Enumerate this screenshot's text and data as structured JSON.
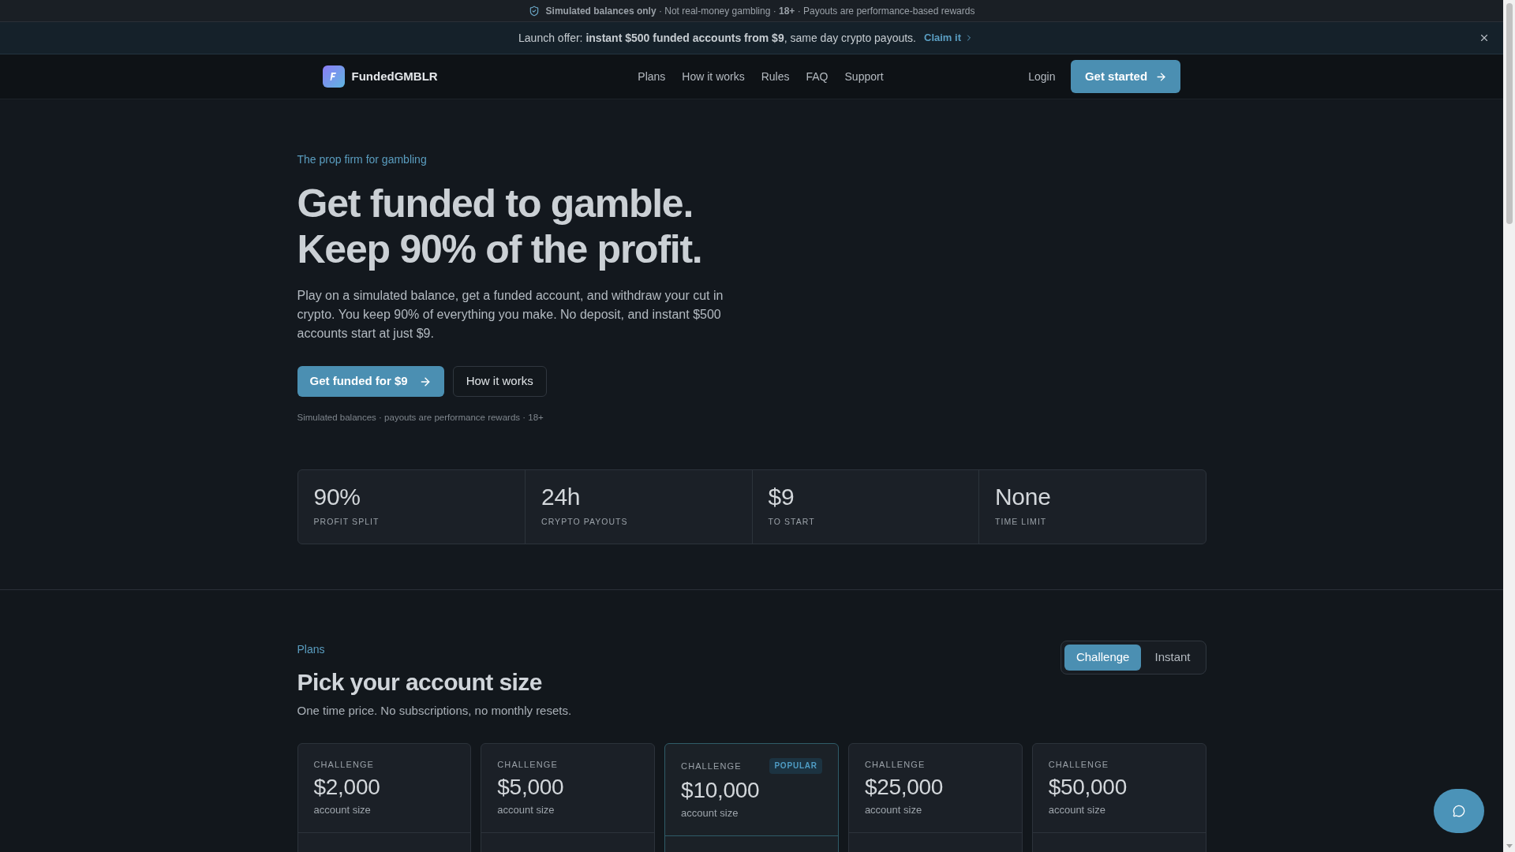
{
  "notice_bar": {
    "text": "**Simulated balances only** · Not real-money gambling · **18+** · Payouts are performance-based rewards"
  },
  "offer_bar": {
    "text": "Launch offer: **instant $500 funded accounts from $9**, same day crypto payouts.",
    "link": "Claim it"
  },
  "nav": {
    "brand": "FundedGMBLR",
    "links": [
      "Plans",
      "How it works",
      "Rules",
      "FAQ",
      "Support"
    ],
    "login": "Login",
    "cta": "Get started"
  },
  "hero": {
    "eyebrow": "The prop firm for gambling",
    "headline": [
      "Get funded to gamble.",
      "Keep 90% of the profit."
    ],
    "body": "Play on a simulated balance, get a funded account, and withdraw your cut in crypto. You keep 90% of everything you make. No deposit, and instant $500 accounts start at just $9.",
    "buttons": [
      {
        "label": "Get funded for $9",
        "kind": "primary"
      },
      {
        "label": "How it works",
        "kind": "secondary"
      }
    ],
    "note": "Simulated balances · payouts are performance rewards · 18+"
  },
  "stats": [
    {
      "value": "90%",
      "label": "PROFIT SPLIT"
    },
    {
      "value": "24h",
      "label": "CRYPTO PAYOUTS"
    },
    {
      "value": "$9",
      "label": "TO START"
    },
    {
      "value": "None",
      "label": "TIME LIMIT"
    }
  ],
  "plans": {
    "eyebrow": "Plans",
    "title": "Pick your account size",
    "subtitle": "One time price. No subscriptions, no monthly resets.",
    "toggle": [
      {
        "label": "Challenge",
        "selected": true
      },
      {
        "label": "Instant",
        "selected": false
      }
    ],
    "cards": [
      {
        "type_label": "CHALLENGE",
        "price": "$2,000",
        "caption": "account size",
        "popular": false
      },
      {
        "type_label": "CHALLENGE",
        "price": "$5,000",
        "caption": "account size",
        "popular": false
      },
      {
        "type_label": "CHALLENGE",
        "price": "$10,000",
        "caption": "account size",
        "popular": true,
        "badge": "POPULAR"
      },
      {
        "type_label": "CHALLENGE",
        "price": "$25,000",
        "caption": "account size",
        "popular": false
      },
      {
        "type_label": "CHALLENGE",
        "price": "$50,000",
        "caption": "account size",
        "popular": false
      }
    ]
  }
}
